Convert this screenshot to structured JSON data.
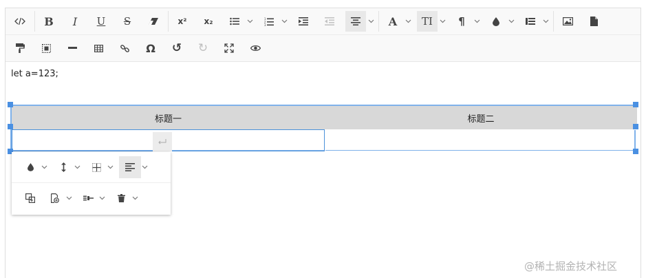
{
  "toolbar": {
    "row1": [
      {
        "name": "code-icon",
        "glyph": "</>"
      },
      {
        "name": "bold-icon",
        "glyph": "B"
      },
      {
        "name": "italic-icon",
        "glyph": "I"
      },
      {
        "name": "underline-icon",
        "glyph": "U"
      },
      {
        "name": "strikethrough-icon",
        "glyph": "S"
      },
      {
        "name": "clear-format-icon",
        "glyph": "⌫"
      },
      {
        "name": "superscript-icon",
        "glyph": "x²"
      },
      {
        "name": "subscript-icon",
        "glyph": "x₂"
      },
      {
        "name": "bullet-list-icon",
        "glyph": "≡"
      },
      {
        "name": "numbered-list-icon",
        "glyph": "≡"
      },
      {
        "name": "indent-icon",
        "glyph": "⇥"
      },
      {
        "name": "outdent-icon",
        "glyph": "⇤"
      },
      {
        "name": "align-center-icon",
        "glyph": "≡"
      },
      {
        "name": "font-color-icon",
        "glyph": "A"
      },
      {
        "name": "font-size-icon",
        "glyph": "TI"
      },
      {
        "name": "paragraph-icon",
        "glyph": "¶"
      },
      {
        "name": "background-color-icon",
        "glyph": "●"
      },
      {
        "name": "line-height-icon",
        "glyph": "≣"
      },
      {
        "name": "image-icon",
        "glyph": "▣"
      },
      {
        "name": "file-icon",
        "glyph": "▮"
      }
    ],
    "row2": [
      {
        "name": "format-painter-icon",
        "glyph": "▤"
      },
      {
        "name": "select-all-icon",
        "glyph": "▢"
      },
      {
        "name": "horizontal-rule-icon",
        "glyph": "—"
      },
      {
        "name": "table-icon",
        "glyph": "▦"
      },
      {
        "name": "link-icon",
        "glyph": "∞"
      },
      {
        "name": "special-char-icon",
        "glyph": "Ω"
      },
      {
        "name": "undo-icon",
        "glyph": "↺"
      },
      {
        "name": "redo-icon",
        "glyph": "↻"
      },
      {
        "name": "fullscreen-icon",
        "glyph": "⤢"
      },
      {
        "name": "preview-icon",
        "glyph": "◉"
      }
    ]
  },
  "content": {
    "code_text": "let a=123;",
    "table": {
      "headers": [
        "标题一",
        "标题二"
      ],
      "rows": [
        [
          "",
          ""
        ]
      ]
    }
  },
  "table_popup": {
    "row1": [
      "cell-background-icon",
      "cell-height-icon",
      "table-borders-icon",
      "cell-align-icon"
    ],
    "row2": [
      "merge-cells-icon",
      "insert-row-icon",
      "insert-column-icon",
      "delete-icon"
    ]
  },
  "watermark": "@稀土掘金技术社区",
  "colors": {
    "selection": "#7fb1ea",
    "header_bg": "#d8d8d8",
    "toolbar_bg": "#f9f9f9"
  }
}
